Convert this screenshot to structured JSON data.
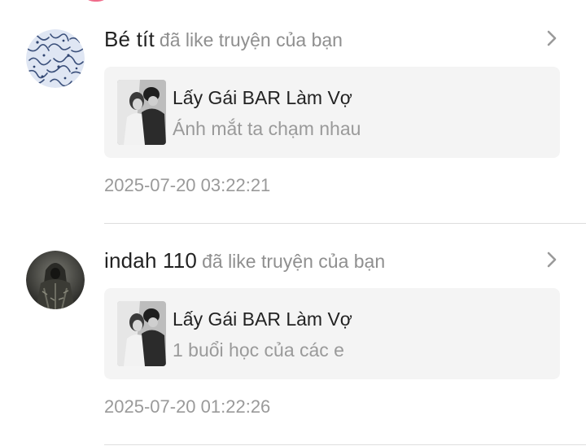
{
  "colors": {
    "username": "#222222",
    "muted": "#9a9a9a",
    "card_background": "#f4f4f4",
    "divider": "#dedede",
    "accent": "#f06b8a"
  },
  "notifications": [
    {
      "username": "Bé tít",
      "action": "đã like truyện của bạn",
      "avatar_icon": "patterned-avatar",
      "chevron_icon": "chevron-right-icon",
      "story": {
        "title": "Lấy Gái BAR Làm Vợ",
        "chapter": "Ánh mắt ta chạm nhau"
      },
      "timestamp": "2025-07-20 03:22:21"
    },
    {
      "username": "indah 110",
      "action": "đã like truyện của bạn",
      "avatar_icon": "dark-figure-avatar",
      "chevron_icon": "chevron-right-icon",
      "story": {
        "title": "Lấy Gái BAR Làm Vợ",
        "chapter": "1 buổi học của các e"
      },
      "timestamp": "2025-07-20 01:22:26"
    }
  ]
}
